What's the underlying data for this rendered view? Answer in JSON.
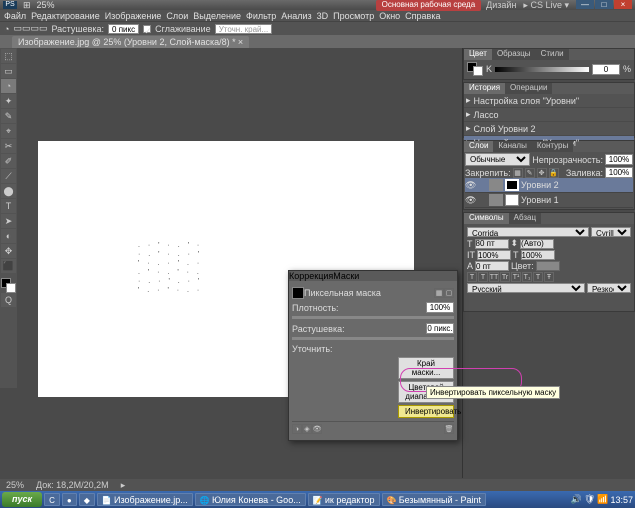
{
  "app": {
    "logo": "PS",
    "zoom_drop": "25%",
    "arrange": "⊞"
  },
  "workspace": {
    "main_btn": "Основная рабочая среда",
    "design": "Дизайн",
    "cslive": "CS Live"
  },
  "menu": [
    "Файл",
    "Редактирование",
    "Изображение",
    "Слои",
    "Выделение",
    "Фильтр",
    "Анализ",
    "3D",
    "Просмотр",
    "Окно",
    "Справка"
  ],
  "options": {
    "feather_label": "Растушевка:",
    "feather_val": "0 пикс",
    "antialias": "Сглаживание",
    "refine": "Уточн. край..."
  },
  "doc_tab": "Изображение.jpg @ 25% (Уровни 2, Слой-маска/8) *",
  "tools": [
    "⬚",
    "▭",
    "◔",
    "✦",
    "✎",
    "⌖",
    "✂",
    "✐",
    "⟋",
    "⬤",
    "T",
    "➤",
    "◐",
    "✥",
    "⬛",
    "Q"
  ],
  "color_panel": {
    "tabs": [
      "Цвет",
      "Образцы",
      "Стили"
    ],
    "channel": "K",
    "value": "0",
    "pct": "%"
  },
  "history_panel": {
    "tabs": [
      "История",
      "Операции"
    ],
    "items": [
      "Настройка слоя \"Уровни\"",
      "Лассо",
      "Слой Уровни 2",
      "Настройка слоя \"Уровни\""
    ]
  },
  "layers_panel": {
    "tabs": [
      "Слои",
      "Каналы",
      "Контуры"
    ],
    "blend": "Обычные",
    "opacity_label": "Непрозрачность:",
    "opacity": "100%",
    "lock_label": "Закрепить:",
    "fill_label": "Заливка:",
    "fill": "100%",
    "rows": [
      {
        "name": "Уровни 2",
        "sel": true,
        "adj": true
      },
      {
        "name": "Уровни 1",
        "sel": false,
        "adj": true
      }
    ]
  },
  "char_panel": {
    "tabs": [
      "Символы",
      "Абзац"
    ],
    "font": "Corrida",
    "style": "Cyrillic",
    "size": "80 пт",
    "lead": "(Авто)",
    "track": "100%",
    "kern": "100%",
    "baseline": "0 пт",
    "color_label": "Цвет:",
    "lang": "Русский",
    "aa": "Резкое"
  },
  "masks": {
    "tabs": [
      "Коррекция",
      "Маски"
    ],
    "title": "Пиксельная маска",
    "density_label": "Плотность:",
    "density": "100%",
    "feather_label": "Растушевка:",
    "feather": "0 пикс.",
    "refine_label": "Уточнить:",
    "btn_edge": "Край маски...",
    "btn_color": "Цветовой диапазон...",
    "btn_invert": "Инвертировать",
    "tooltip": "Инвертировать пиксельную маску"
  },
  "status": {
    "zoom": "25%",
    "doc": "Док: 18,2M/20,2M"
  },
  "taskbar": {
    "start": "пуск",
    "items": [
      "Изображение.jp...",
      "Юлия Конева - Goo...",
      "ик редактор",
      "Безымянный - Paint"
    ],
    "time": "13:57"
  }
}
